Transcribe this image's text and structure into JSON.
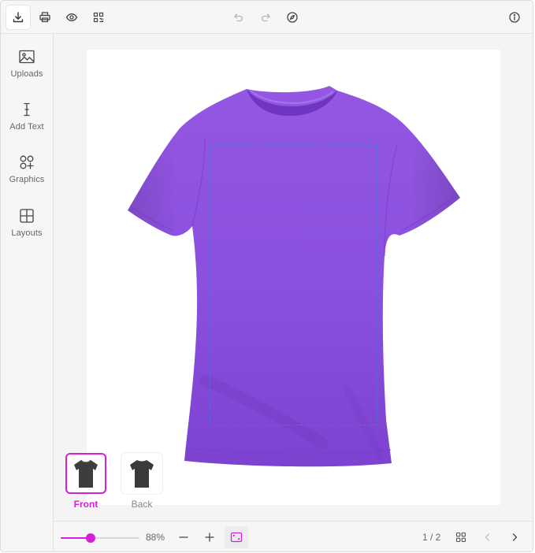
{
  "toolbar": {
    "icons": [
      "download-icon",
      "print-icon",
      "eye-icon",
      "qr-code-icon",
      "undo-icon",
      "redo-icon",
      "compass-icon",
      "info-icon"
    ],
    "accent": "#d61fd6"
  },
  "sidebar": {
    "items": [
      {
        "label": "Uploads",
        "icon": "image-icon"
      },
      {
        "label": "Add Text",
        "icon": "text-cursor-icon"
      },
      {
        "label": "Graphics",
        "icon": "shapes-icon"
      },
      {
        "label": "Layouts",
        "icon": "layout-grid-icon"
      }
    ]
  },
  "canvas": {
    "product_color": "#8a4fe0",
    "print_area_border": "#4a73d8"
  },
  "views": [
    {
      "label": "Front",
      "selected": true
    },
    {
      "label": "Back",
      "selected": false
    }
  ],
  "zoom": {
    "value_label": "88%",
    "percent": 88
  },
  "pagination": {
    "label": "1 / 2"
  }
}
